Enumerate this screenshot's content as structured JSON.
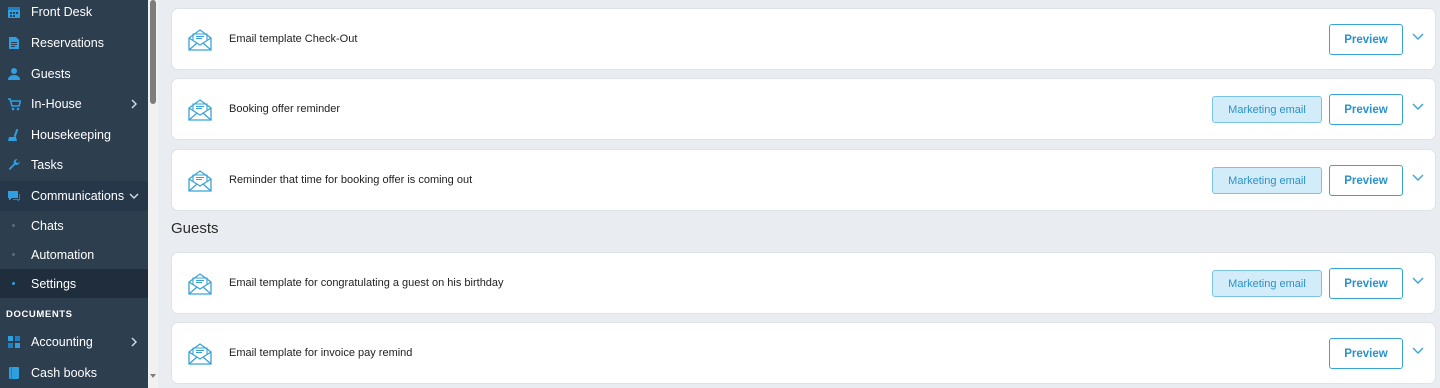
{
  "sidebar": {
    "items": [
      {
        "label": "Front Desk",
        "icon": "calendar-icon"
      },
      {
        "label": "Reservations",
        "icon": "document-icon"
      },
      {
        "label": "Guests",
        "icon": "person-icon"
      },
      {
        "label": "In-House",
        "icon": "cart-icon"
      },
      {
        "label": "Housekeeping",
        "icon": "broom-icon"
      },
      {
        "label": "Tasks",
        "icon": "wrench-icon"
      },
      {
        "label": "Communications",
        "icon": "chat-icon"
      }
    ],
    "sub_items": [
      {
        "label": "Chats"
      },
      {
        "label": "Automation"
      },
      {
        "label": "Settings"
      }
    ],
    "section_label": "DOCUMENTS",
    "doc_items": [
      {
        "label": "Accounting",
        "icon": "grid-icon"
      },
      {
        "label": "Cash books",
        "icon": "book-icon"
      }
    ]
  },
  "main": {
    "templates": [
      {
        "title": "Email template Check-Out",
        "preview_label": "Preview"
      },
      {
        "title": "Booking offer reminder",
        "badge": "Marketing email",
        "preview_label": "Preview"
      },
      {
        "title": "Reminder that time for booking offer is coming out",
        "badge": "Marketing email",
        "preview_label": "Preview"
      }
    ],
    "guests_heading": "Guests",
    "guest_templates": [
      {
        "title": "Email template for congratulating a guest on his birthday",
        "badge": "Marketing email",
        "preview_label": "Preview"
      },
      {
        "title": "Email template for invoice pay remind",
        "preview_label": "Preview"
      }
    ]
  },
  "colors": {
    "sidebar_bg": "#2d3e4f",
    "accent": "#2a91c9",
    "icon_blue": "#2f9fe0"
  }
}
